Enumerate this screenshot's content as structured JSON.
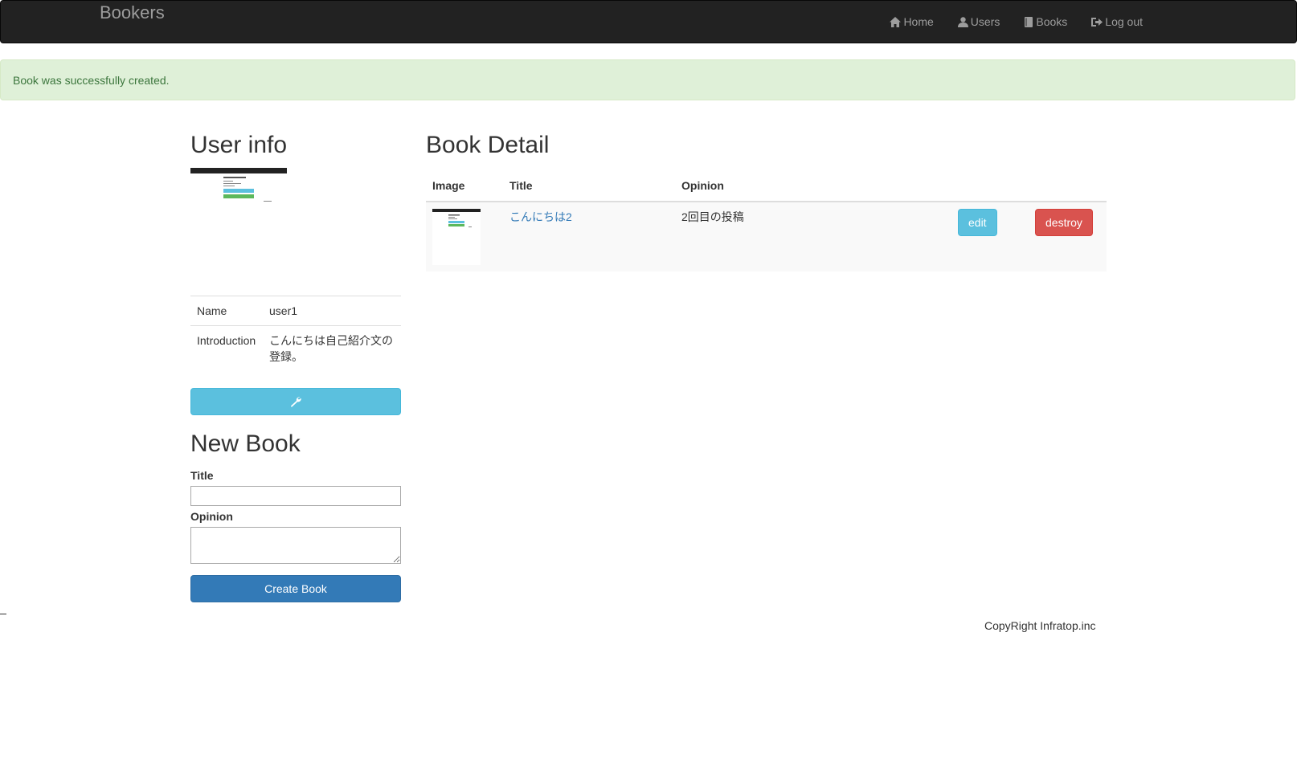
{
  "navbar": {
    "brand": "Bookers",
    "items": [
      {
        "label": "Home",
        "icon": "home-icon"
      },
      {
        "label": "Users",
        "icon": "user-icon"
      },
      {
        "label": "Books",
        "icon": "book-icon"
      },
      {
        "label": "Log out",
        "icon": "log-out-icon"
      }
    ]
  },
  "flash": {
    "message": "Book was successfully created."
  },
  "user_info": {
    "heading": "User info",
    "rows": [
      {
        "label": "Name",
        "value": "user1"
      },
      {
        "label": "Introduction",
        "value": "こんにちは自己紹介文の登録。"
      }
    ],
    "edit_icon": "wrench-icon"
  },
  "new_book": {
    "heading": "New Book",
    "title_label": "Title",
    "title_value": "",
    "opinion_label": "Opinion",
    "opinion_value": "",
    "submit_label": "Create Book"
  },
  "book_detail": {
    "heading": "Book Detail",
    "columns": [
      "Image",
      "Title",
      "Opinion"
    ],
    "book": {
      "title": "こんにちは2",
      "opinion": "2回目の投稿",
      "edit_label": "edit",
      "destroy_label": "destroy"
    }
  },
  "footer": {
    "text": "CopyRight Infratop.inc"
  },
  "colors": {
    "navbar_bg": "#222222",
    "alert_bg": "#dff0d8",
    "alert_text": "#3c763d",
    "info_button": "#5bc0de",
    "primary_button": "#337ab7",
    "danger_button": "#d9534f",
    "link": "#337ab7"
  }
}
